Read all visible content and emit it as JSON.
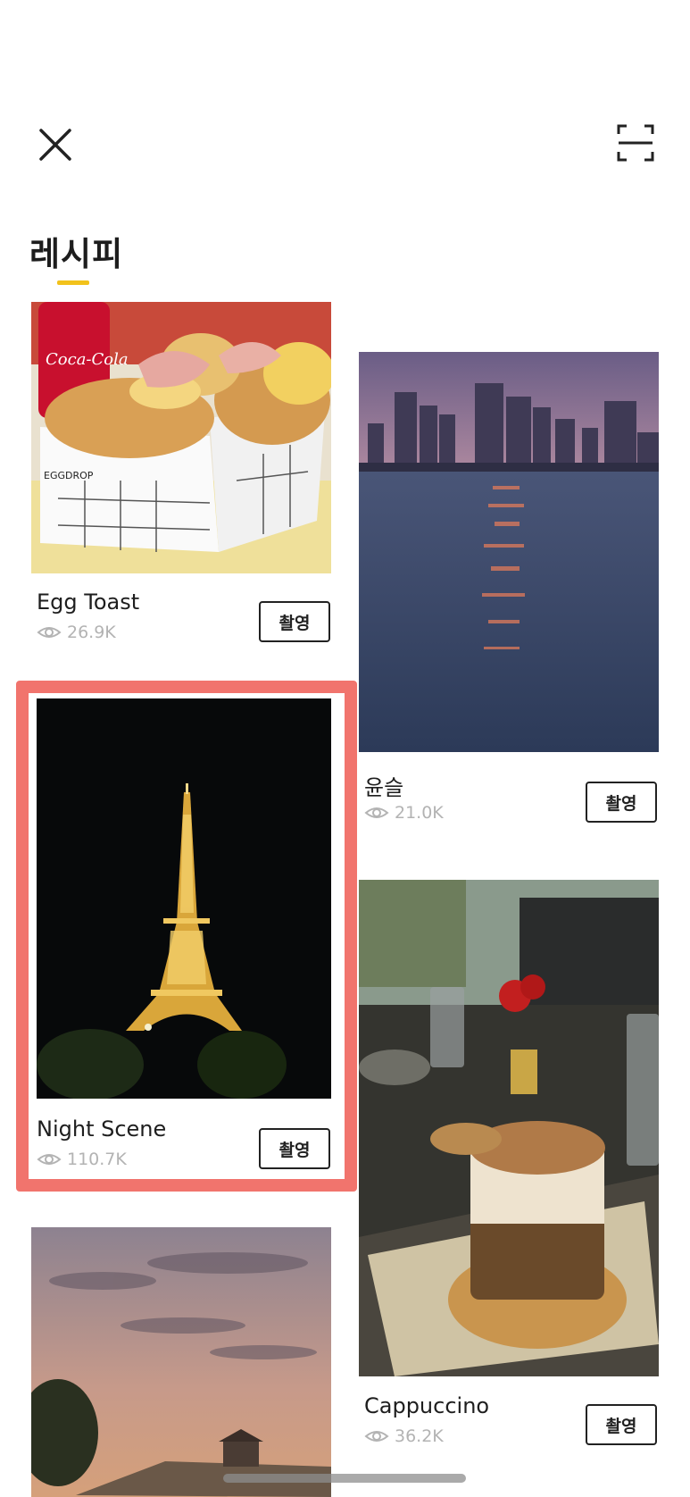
{
  "header": {
    "close_icon": "close-icon",
    "scan_icon": "scan-frame-icon",
    "title": "레시피",
    "accent_color": "#f2c21b"
  },
  "cards": [
    {
      "name": "Egg Toast",
      "views": "26.9K",
      "action": "촬영"
    },
    {
      "name": "윤슬",
      "views": "21.0K",
      "action": "촬영"
    },
    {
      "name": "Night Scene",
      "views": "110.7K",
      "action": "촬영"
    },
    {
      "name": "Cappuccino",
      "views": "36.2K",
      "action": "촬영"
    }
  ],
  "highlight_color": "#ee5c54"
}
